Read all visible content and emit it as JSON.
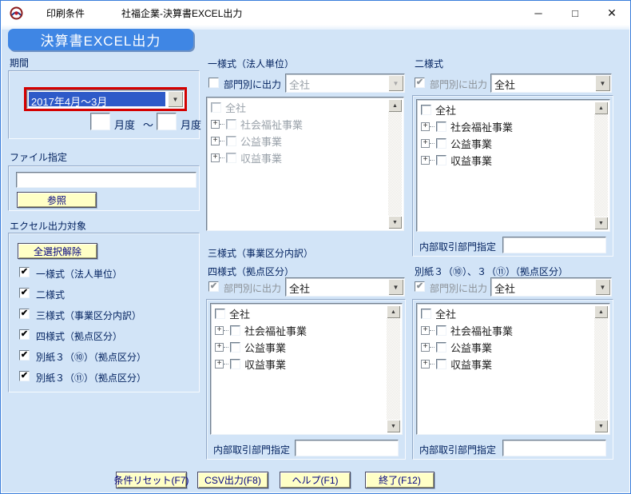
{
  "window": {
    "title_app": "印刷条件",
    "title_doc": "社福企業-決算書EXCEL出力",
    "minimize_icon": "─",
    "maximize_icon": "□",
    "close_icon": "✕"
  },
  "banner": "決算書EXCEL出力",
  "icons": {
    "dropdown": "▼",
    "scroll_up": "▲",
    "scroll_down": "▼",
    "expand": "+"
  },
  "period": {
    "label": "期間",
    "selected": "2017年4月～3月",
    "from_value": "",
    "from_unit": "月度",
    "range_tilde": "～",
    "to_value": "",
    "to_unit": "月度"
  },
  "file": {
    "label": "ファイル指定",
    "path": "",
    "browse": "参照"
  },
  "excel_target": {
    "label": "エクセル出力対象",
    "clear_all": "全選択解除",
    "items": [
      {
        "label": "一様式（法人単位）",
        "glyph": "✔"
      },
      {
        "label": "二様式",
        "glyph": "✔"
      },
      {
        "label": "三様式（事業区分内訳）",
        "glyph": "✔"
      },
      {
        "label": "四様式（拠点区分）",
        "glyph": "✔"
      },
      {
        "label": "別紙３（⑩）（拠点区分）",
        "glyph": "✔"
      },
      {
        "label": "別紙３（⑪）（拠点区分）",
        "glyph": "✔"
      }
    ]
  },
  "panels": [
    {
      "title": "一様式（法人単位）",
      "dept_label": "部門別に出力",
      "dept_glyph": "",
      "company": "全社",
      "tree": [
        "全社",
        "社会福祉事業",
        "公益事業",
        "収益事業"
      ]
    },
    {
      "title": "二様式",
      "dept_label": "部門別に出力",
      "dept_glyph": "✔",
      "company": "全社",
      "tree": [
        "全社",
        "社会福祉事業",
        "公益事業",
        "収益事業"
      ],
      "internal_label": "内部取引部門指定",
      "internal_value": ""
    },
    {
      "title": "三様式（事業区分内訳）",
      "title2": "四様式（拠点区分）",
      "dept_label": "部門別に出力",
      "dept_glyph": "✔",
      "company": "全社",
      "tree": [
        "全社",
        "社会福祉事業",
        "公益事業",
        "収益事業"
      ],
      "internal_label": "内部取引部門指定",
      "internal_value": ""
    },
    {
      "title": "別紙３（⑩）、３（⑪）（拠点区分）",
      "dept_label": "部門別に出力",
      "dept_glyph": "✔",
      "company": "全社",
      "tree": [
        "全社",
        "社会福祉事業",
        "公益事業",
        "収益事業"
      ],
      "internal_label": "内部取引部門指定",
      "internal_value": ""
    }
  ],
  "footer": {
    "buttons": [
      "条件リセット(F7)",
      "CSV出力(F8)",
      "ヘルプ(F1)",
      "終了(F12)"
    ]
  },
  "colors": {
    "accent_blue": "#3f86e4",
    "highlight_red": "#d40000",
    "selection_blue": "#2e5ac8",
    "button_yellow": "#ffffc6",
    "content_bg": "#d2e4f7"
  }
}
